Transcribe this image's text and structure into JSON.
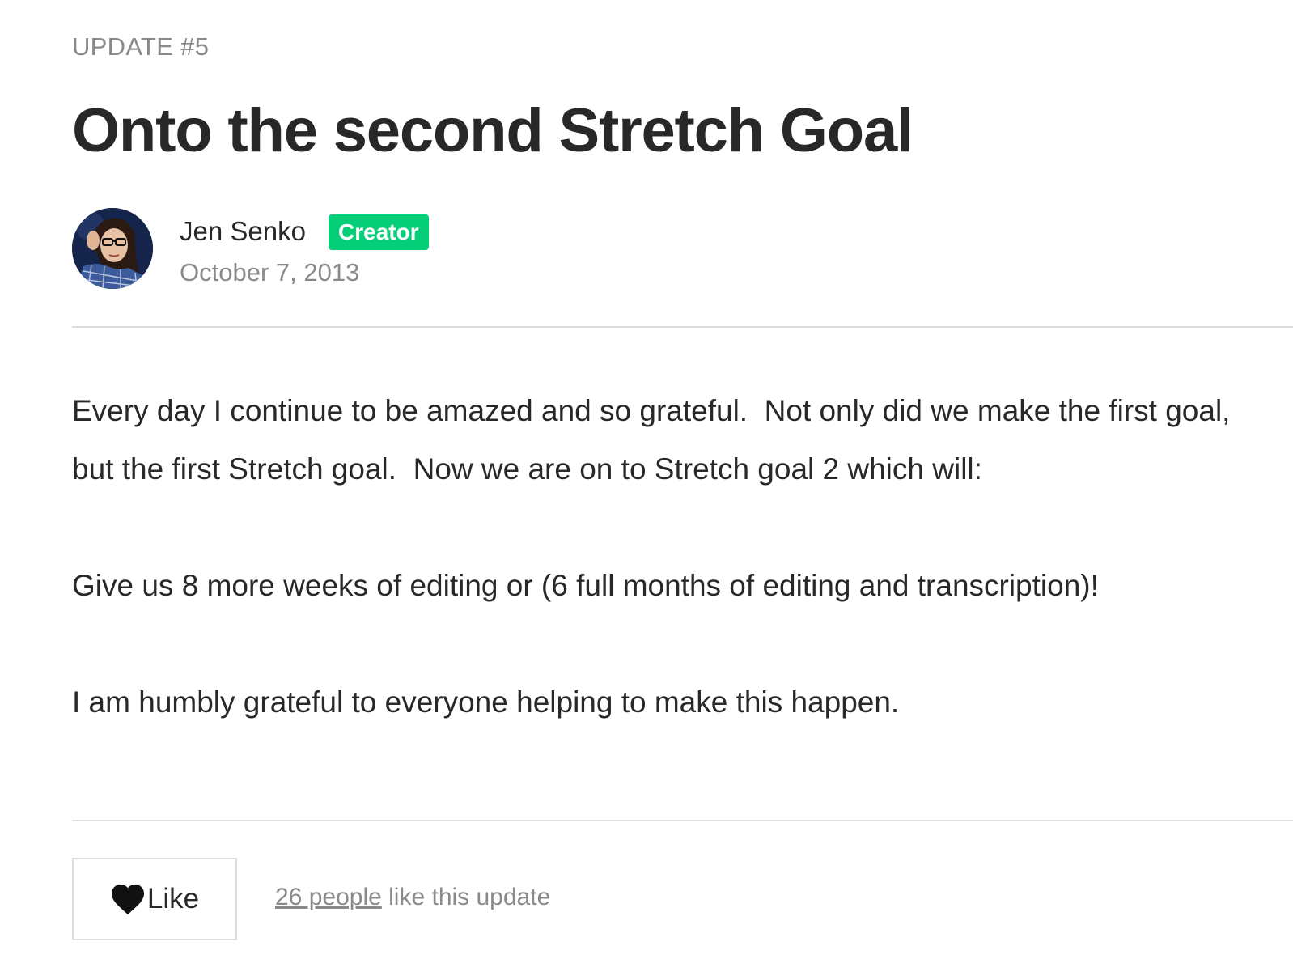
{
  "update": {
    "label": "UPDATE #5",
    "title": "Onto the second Stretch Goal"
  },
  "author": {
    "name": "Jen Senko",
    "badge": "Creator",
    "date": "October 7, 2013",
    "avatar_icon": "author-photo",
    "badge_color": "#05ce78"
  },
  "body": {
    "paragraphs": [
      "Every day I continue to be amazed and so grateful.  Not only did we make the first goal, but the first Stretch goal.  Now we are on to Stretch goal 2 which will:",
      "Give us 8 more weeks of editing or (6 full months of editing and transcription)!",
      "I am humbly grateful to everyone helping to make this happen."
    ]
  },
  "likes": {
    "button_label": "Like",
    "button_icon": "heart-icon",
    "count_link": "26 people",
    "count_suffix": " like this update"
  }
}
